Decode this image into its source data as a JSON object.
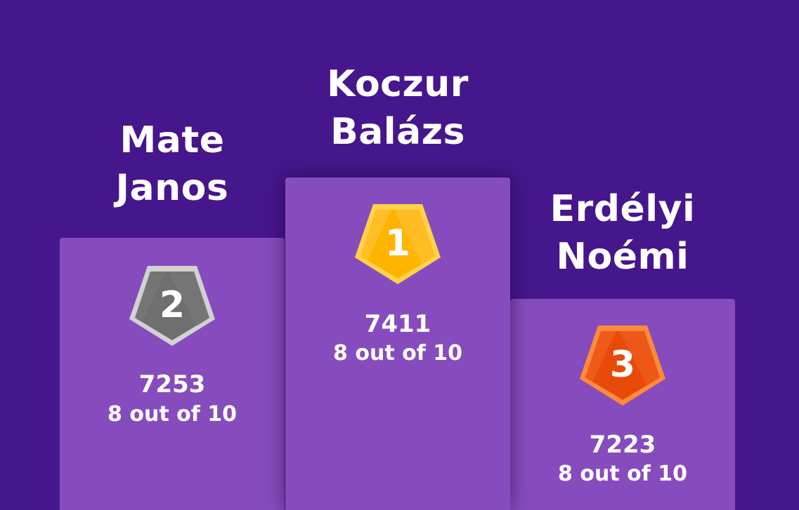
{
  "podium": {
    "first": {
      "rank": "1",
      "name_line1": "Koczur",
      "name_line2": "Balázs",
      "score": "7411",
      "result": "8 out of 10",
      "badge_colors": {
        "fill": "#ffb400",
        "stroke": "#ffd24a",
        "shade": "#f7a200"
      }
    },
    "second": {
      "rank": "2",
      "name_line1": "Mate",
      "name_line2": "Janos",
      "score": "7253",
      "result": "8 out of 10",
      "badge_colors": {
        "fill": "#6f6f6f",
        "stroke": "#cfcfcf",
        "shade": "#5f5f5f"
      }
    },
    "third": {
      "rank": "3",
      "name_line1": "Erdélyi",
      "name_line2": "Noémi",
      "score": "7223",
      "result": "8 out of 10",
      "badge_colors": {
        "fill": "#e84a0a",
        "stroke": "#ff8a3a",
        "shade": "#d43a00"
      }
    }
  },
  "colors": {
    "background": "#46168c",
    "podium": "#864cbd",
    "text": "#ffffff"
  },
  "icons": {
    "badge": "pentagon-medal-icon"
  }
}
